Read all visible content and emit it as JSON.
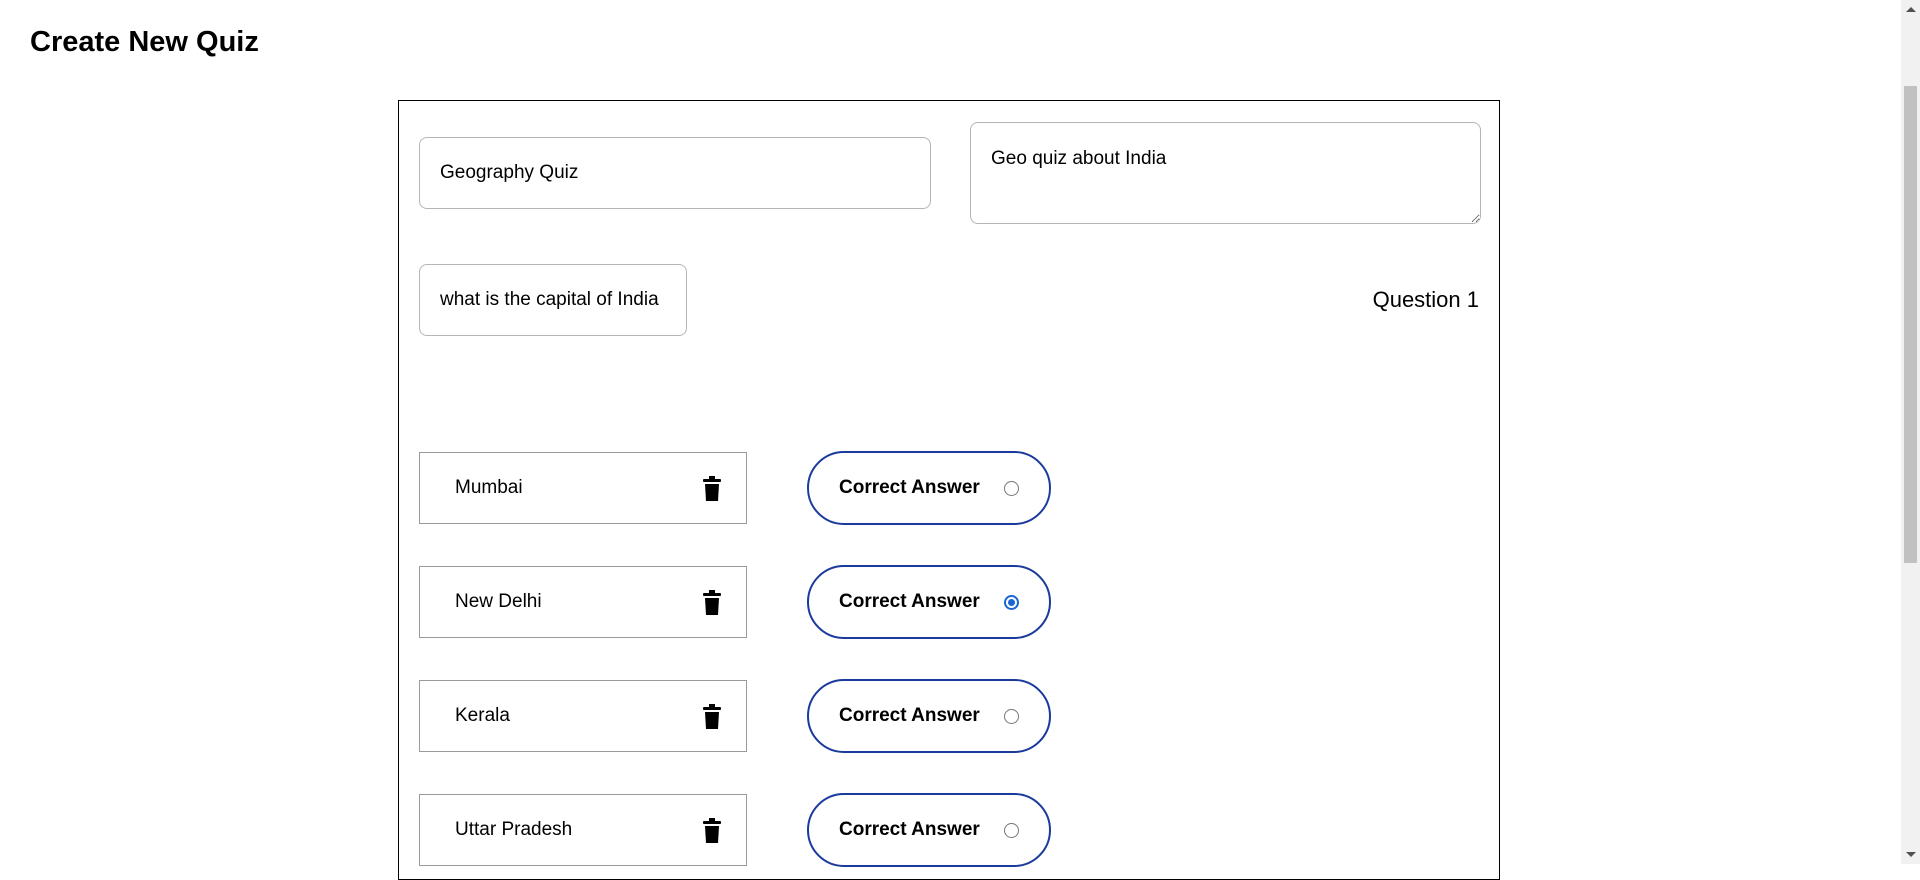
{
  "page": {
    "title": "Create New Quiz"
  },
  "quiz": {
    "title_value": "Geography Quiz",
    "description_value": "Geo quiz about India",
    "question_text": "what is the capital of India",
    "question_label": "Question 1",
    "options": [
      {
        "text": "Mumbai",
        "correct_label": "Correct Answer",
        "selected": false
      },
      {
        "text": "New Delhi",
        "correct_label": "Correct Answer",
        "selected": true
      },
      {
        "text": "Kerala",
        "correct_label": "Correct Answer",
        "selected": false
      },
      {
        "text": "Uttar Pradesh",
        "correct_label": "Correct Answer",
        "selected": false
      }
    ]
  },
  "icons": {
    "delete": "trash-icon"
  },
  "colors": {
    "accent_border": "#1a3a9c",
    "radio_selected": "#1a66d2"
  }
}
